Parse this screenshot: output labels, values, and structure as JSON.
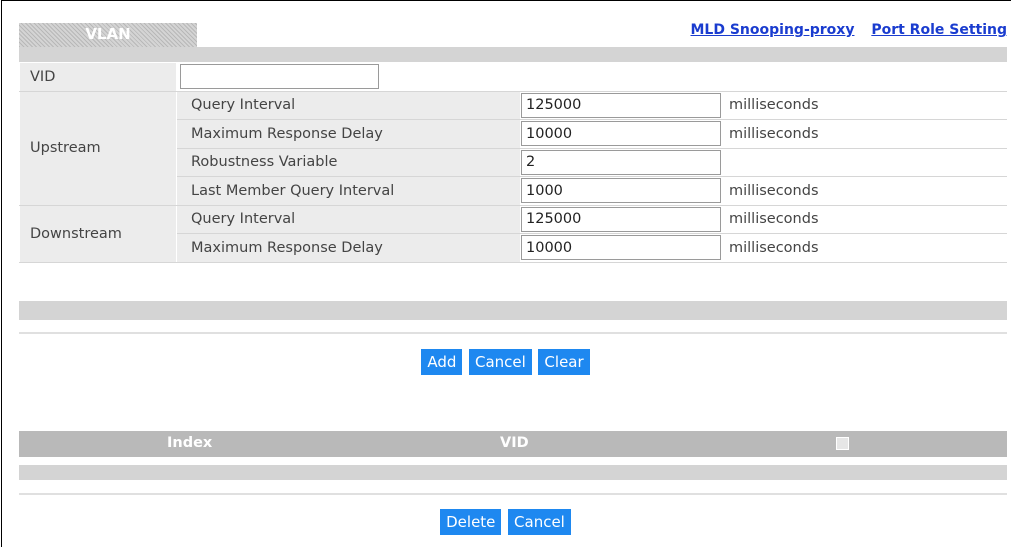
{
  "tabs": {
    "active": "VLAN"
  },
  "links": [
    {
      "label": "MLD Snooping-proxy"
    },
    {
      "label": "Port Role Setting"
    }
  ],
  "form": {
    "vid": {
      "label": "VID",
      "value": ""
    },
    "upstream": {
      "label": "Upstream",
      "rows": [
        {
          "label": "Query Interval",
          "value": "125000",
          "unit": "milliseconds"
        },
        {
          "label": "Maximum Response Delay",
          "value": "10000",
          "unit": "milliseconds"
        },
        {
          "label": "Robustness Variable",
          "value": "2",
          "unit": ""
        },
        {
          "label": "Last Member Query Interval",
          "value": "1000",
          "unit": "milliseconds"
        }
      ]
    },
    "downstream": {
      "label": "Downstream",
      "rows": [
        {
          "label": "Query Interval",
          "value": "125000",
          "unit": "milliseconds"
        },
        {
          "label": "Maximum Response Delay",
          "value": "10000",
          "unit": "milliseconds"
        }
      ]
    }
  },
  "buttons": {
    "add": "Add",
    "cancel": "Cancel",
    "clear": "Clear",
    "delete": "Delete",
    "cancel2": "Cancel"
  },
  "list": {
    "columns": {
      "index": "Index",
      "vid": "VID"
    }
  },
  "colors": {
    "accent": "#1e88f0",
    "link": "#1a3ccf",
    "header_gray": "#b9b9b9"
  }
}
